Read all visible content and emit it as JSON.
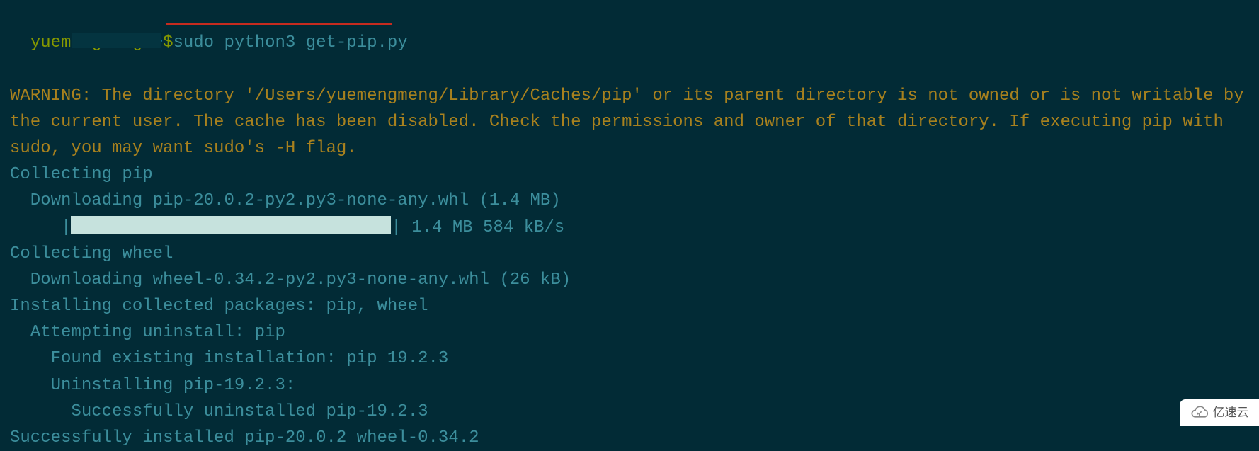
{
  "prompt": {
    "user_prefix": "yu",
    "user_hidden": "emengmeng",
    "sep": ":",
    "path": "~",
    "dollar": "$",
    "command": "sudo python3 get-pip.py"
  },
  "warning": "WARNING: The directory '/Users/yuemengmeng/Library/Caches/pip' or its parent directory is not owned or is not writable by the current user. The cache has been disabled. Check the permissions and owner of that directory. If executing pip with sudo, you may want sudo's -H flag.",
  "lines": {
    "l1": "Collecting pip",
    "l2": "  Downloading pip-20.0.2-py2.py3-none-any.whl (1.4 MB)",
    "l3_pre": "     |",
    "l3_post": "| 1.4 MB 584 kB/s",
    "l4": "Collecting wheel",
    "l5": "  Downloading wheel-0.34.2-py2.py3-none-any.whl (26 kB)",
    "l6": "Installing collected packages: pip, wheel",
    "l7": "  Attempting uninstall: pip",
    "l8": "    Found existing installation: pip 19.2.3",
    "l9": "    Uninstalling pip-19.2.3:",
    "l10": "      Successfully uninstalled pip-19.2.3",
    "l11": "Successfully installed pip-20.0.2 wheel-0.34.2"
  },
  "watermark": {
    "text": "亿速云"
  }
}
